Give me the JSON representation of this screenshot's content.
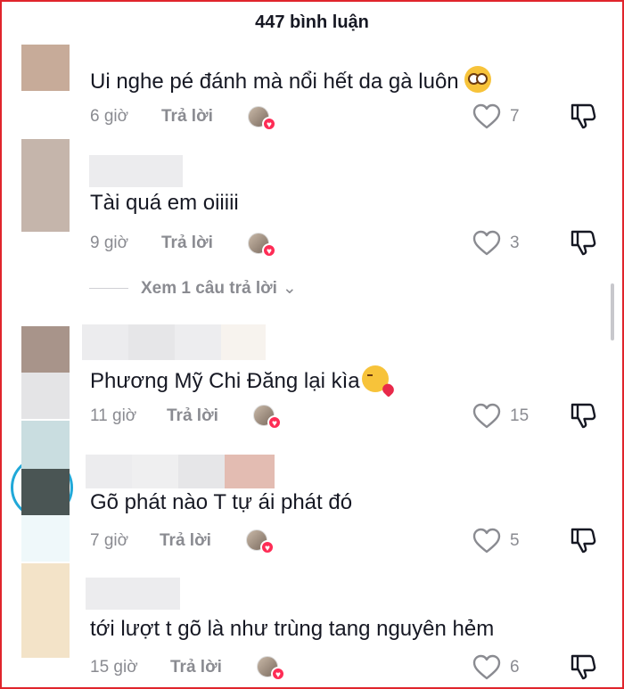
{
  "header": {
    "title": "447 bình luận"
  },
  "colors": {
    "frame": "#e0242c",
    "accent": "#fe2c55",
    "muted": "#8a8b91",
    "text": "#161823"
  },
  "comments": [
    {
      "text": "Ui nghe pé đánh mà nổi hết da gà luôn",
      "emoji": "flushed-face-emoji",
      "time": "6 giờ",
      "reply_label": "Trả lời",
      "likes": "7"
    },
    {
      "text": "Tài quá em oiiiii",
      "emoji": "",
      "time": "9 giờ",
      "reply_label": "Trả lời",
      "likes": "3"
    },
    {
      "text": "Phương Mỹ Chi Đăng lại kìa",
      "emoji": "kissing-face-emoji",
      "time": "11 giờ",
      "reply_label": "Trả lời",
      "likes": "15"
    },
    {
      "text": "Gõ phát nào T tự ái phát đó",
      "emoji": "",
      "time": "7 giờ",
      "reply_label": "Trả lời",
      "likes": "5"
    },
    {
      "text": "tới lượt t gõ là như trùng tang nguyên hẻm",
      "emoji": "",
      "time": "15 giờ",
      "reply_label": "Trả lời",
      "likes": "6"
    }
  ],
  "view_replies": {
    "label": "Xem 1 câu trả lời",
    "chevron": "⌄"
  },
  "icons": {
    "like": "heart-outline-icon",
    "dislike": "thumbs-down-icon",
    "creator_liked": "creator-heart-badge"
  }
}
